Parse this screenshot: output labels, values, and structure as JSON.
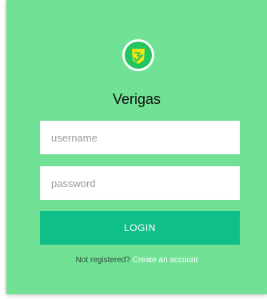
{
  "app": {
    "logo_icon": "shield-check-icon",
    "title": "Verigas"
  },
  "form": {
    "username_placeholder": "username",
    "password_placeholder": "password",
    "login_label": "LOGIN",
    "register_prompt": "Not registered?",
    "register_link": "Create an account"
  },
  "colors": {
    "background": "#70e195",
    "button": "#0fbf87",
    "logo_circle": "#22c55e",
    "logo_badge": "#f5e50a"
  }
}
